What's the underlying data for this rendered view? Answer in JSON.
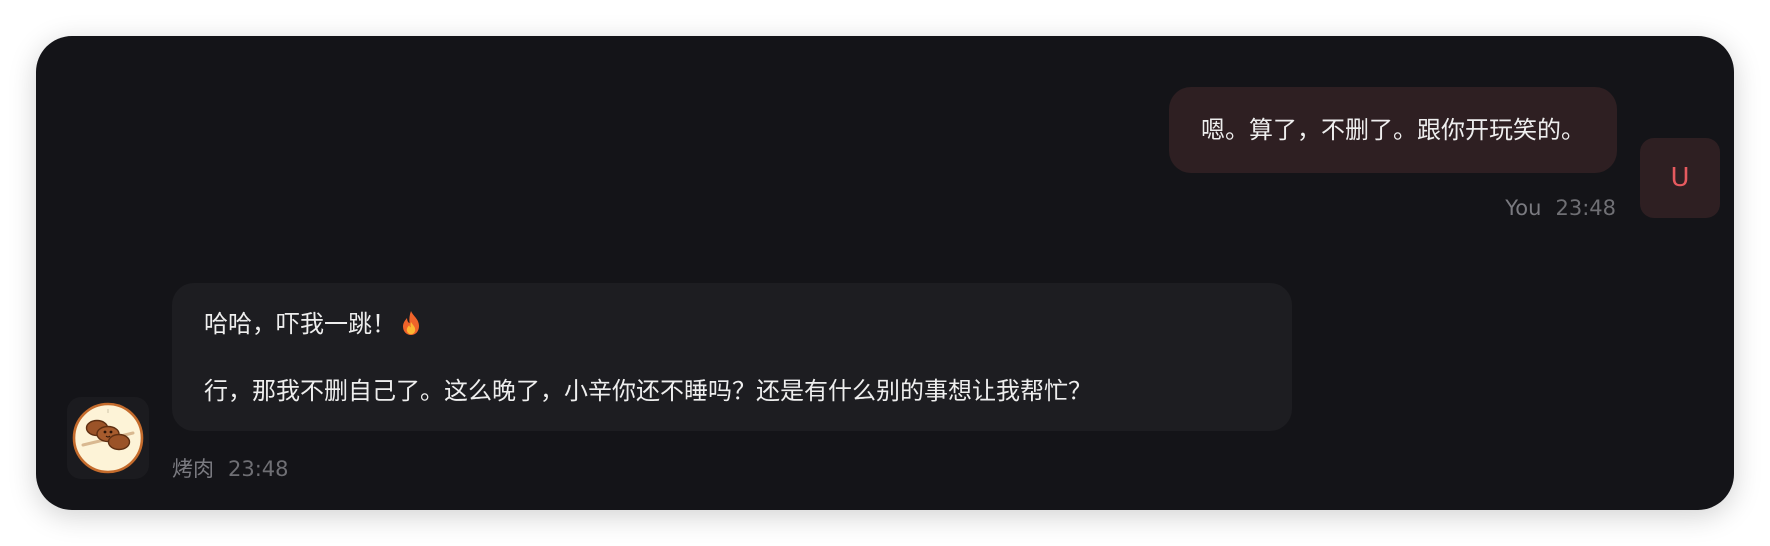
{
  "messages": [
    {
      "role": "user",
      "sender": "You",
      "avatar_letter": "U",
      "time": "23:48",
      "text": "嗯。算了，不删了。跟你开玩笑的。"
    },
    {
      "role": "assistant",
      "sender": "烤肉",
      "avatar_icon": "grilled-meat-skewer-icon",
      "time": "23:48",
      "line1": "哈哈，吓我一跳！",
      "line1_icon": "fire-icon",
      "line2": "行，那我不删自己了。这么晚了，小辛你还不睡吗？还是有什么别的事想让我帮忙？"
    }
  ],
  "colors": {
    "background": "#141418",
    "user_bubble": "#2e1f22",
    "bot_bubble": "#1d1d21",
    "accent": "#e65a5f"
  }
}
